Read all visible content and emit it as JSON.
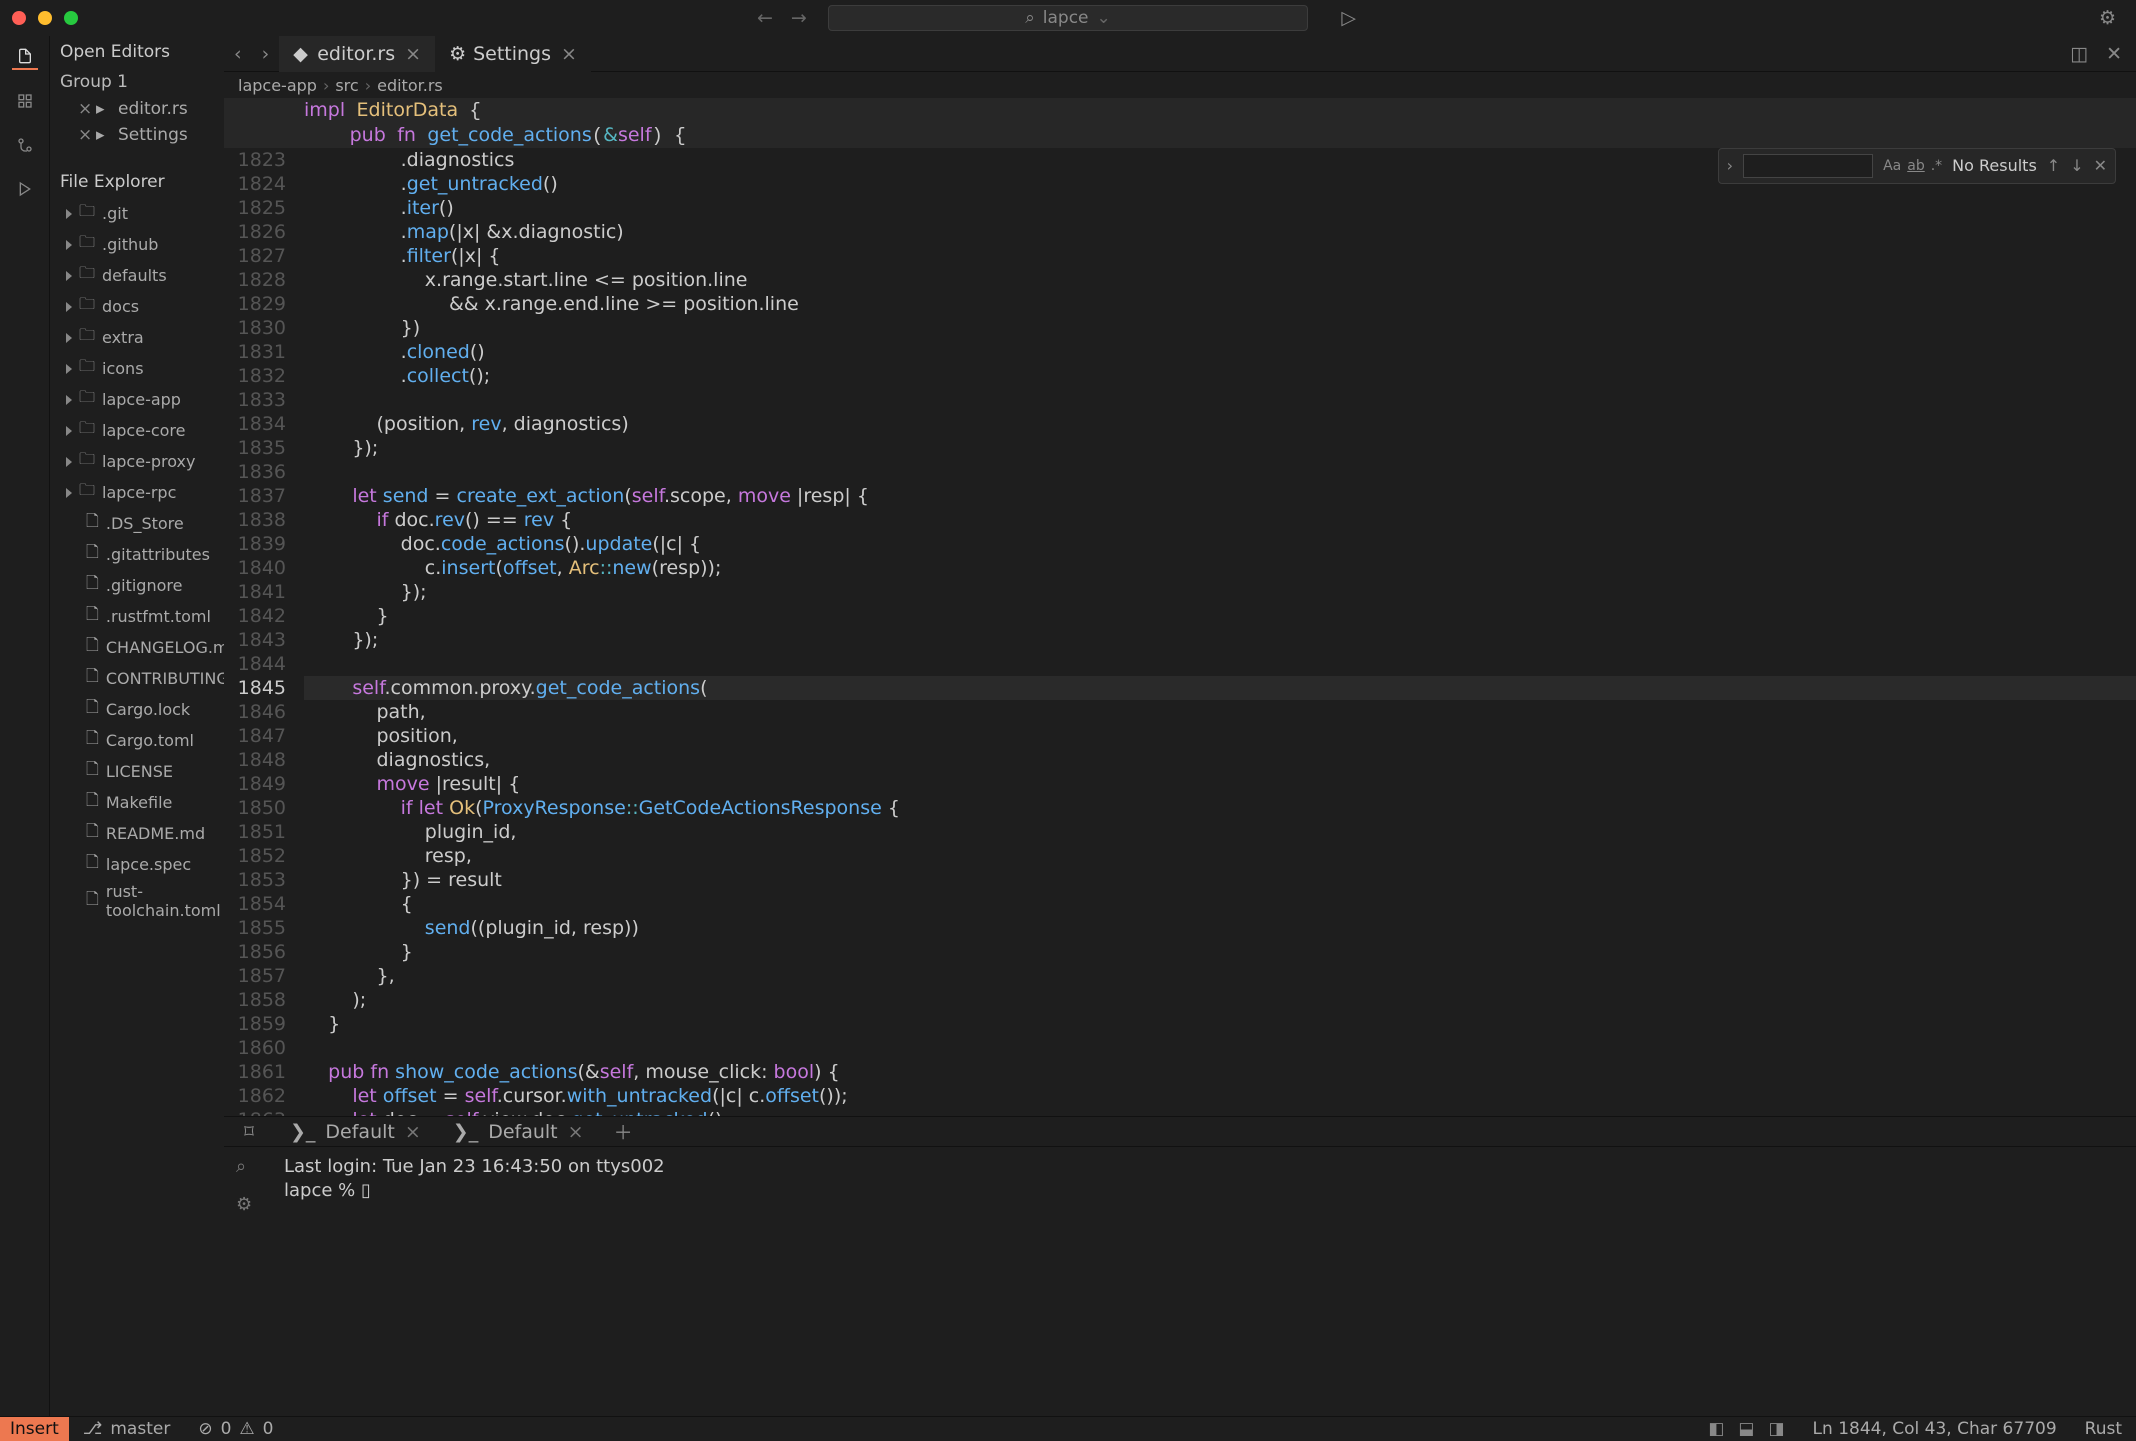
{
  "title": "lapce",
  "tabs": [
    {
      "label": "editor.rs",
      "icon": "rust",
      "active": true
    },
    {
      "label": "Settings",
      "icon": "gear",
      "active": false
    }
  ],
  "breadcrumb": [
    "lapce-app",
    "src",
    "editor.rs"
  ],
  "sticky": [
    {
      "text": "impl EditorData {",
      "cls": ""
    },
    {
      "text": "    pub fn get_code_actions(&self) {",
      "cls": ""
    }
  ],
  "open_editors_label": "Open Editors",
  "group_label": "Group 1",
  "open_editors": [
    {
      "label": "editor.rs"
    },
    {
      "label": "Settings"
    }
  ],
  "file_explorer_label": "File Explorer",
  "tree": [
    {
      "type": "folder",
      "label": ".git"
    },
    {
      "type": "folder",
      "label": ".github"
    },
    {
      "type": "folder",
      "label": "defaults"
    },
    {
      "type": "folder",
      "label": "docs"
    },
    {
      "type": "folder",
      "label": "extra"
    },
    {
      "type": "folder",
      "label": "icons"
    },
    {
      "type": "folder",
      "label": "lapce-app"
    },
    {
      "type": "folder",
      "label": "lapce-core"
    },
    {
      "type": "folder",
      "label": "lapce-proxy"
    },
    {
      "type": "folder",
      "label": "lapce-rpc"
    },
    {
      "type": "file",
      "label": ".DS_Store"
    },
    {
      "type": "file",
      "label": ".gitattributes"
    },
    {
      "type": "file",
      "label": ".gitignore"
    },
    {
      "type": "file",
      "label": ".rustfmt.toml"
    },
    {
      "type": "file",
      "label": "CHANGELOG.md"
    },
    {
      "type": "file",
      "label": "CONTRIBUTING.md"
    },
    {
      "type": "file",
      "label": "Cargo.lock"
    },
    {
      "type": "file",
      "label": "Cargo.toml"
    },
    {
      "type": "file",
      "label": "LICENSE"
    },
    {
      "type": "file",
      "label": "Makefile"
    },
    {
      "type": "file",
      "label": "README.md"
    },
    {
      "type": "file",
      "label": "lapce.spec"
    },
    {
      "type": "file",
      "label": "rust-toolchain.toml"
    }
  ],
  "find": {
    "placeholder": "",
    "results": "No Results"
  },
  "code": {
    "start": 1823,
    "current": 1845,
    "lines": [
      "                .diagnostics",
      "                .get_untracked()",
      "                .iter()",
      "                .map(|x| &x.diagnostic)",
      "                .filter(|x| {",
      "                    x.range.start.line <= position.line",
      "                        && x.range.end.line >= position.line",
      "                })",
      "                .cloned()",
      "                .collect();",
      "",
      "            (position, rev, diagnostics)",
      "        });",
      "",
      "        let send = create_ext_action(self.scope, move |resp| {",
      "            if doc.rev() == rev {",
      "                doc.code_actions().update(|c| {",
      "                    c.insert(offset, Arc::new(resp));",
      "                });",
      "            }",
      "        });",
      "",
      "        self.common.proxy.get_code_actions(",
      "            path,",
      "            position,",
      "            diagnostics,",
      "            move |result| {",
      "                if let Ok(ProxyResponse::GetCodeActionsResponse {",
      "                    plugin_id,",
      "                    resp,",
      "                }) = result",
      "                {",
      "                    send((plugin_id, resp))",
      "                }",
      "            },",
      "        );",
      "    }",
      "",
      "    pub fn show_code_actions(&self, mouse_click: bool) {",
      "        let offset = self.cursor.with_untracked(|c| c.offset());",
      "        let doc = self.view.doc.get_untracked();"
    ]
  },
  "panel": {
    "tabs": [
      {
        "label": "Default"
      },
      {
        "label": "Default"
      }
    ],
    "term_lines": [
      "Last login: Tue Jan 23 16:43:50 on ttys002",
      "lapce % ▯"
    ]
  },
  "status": {
    "mode": "Insert",
    "branch": "master",
    "errors": "0",
    "warnings": "0",
    "position": "Ln 1844, Col 43, Char 67709",
    "lang": "Rust"
  }
}
